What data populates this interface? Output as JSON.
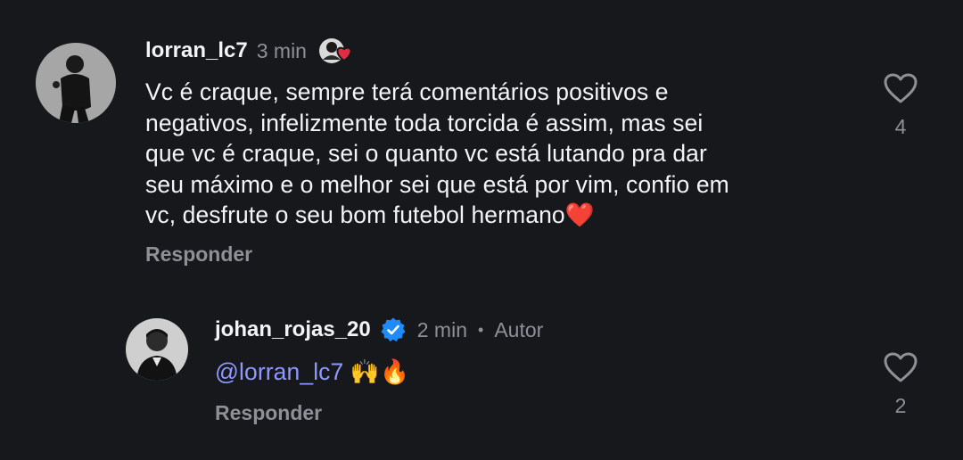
{
  "top_fragment": "·",
  "comments": [
    {
      "username": "lorran_lc7",
      "time": "3 min",
      "text_lines": [
        "Vc é craque, sempre terá comentários positivos e",
        "negativos, infelizmente toda torcida é assim, mas sei",
        "que vc é craque, sei o quanto vc está lutando pra dar",
        "seu máximo e o melhor sei que está por vim, confio em",
        "vc, desfrute o seu bom futebol hermano"
      ],
      "text_emoji": "❤️",
      "reply_label": "Responder",
      "likes": "4",
      "badge_icon": "creator-heart-badge-icon"
    },
    {
      "username": "johan_rojas_20",
      "verified_icon": "verified-check-icon",
      "time": "2 min",
      "dot": "•",
      "author_label": "Autor",
      "mention": "@lorran_lc7",
      "emoji": "🙌🔥",
      "reply_label": "Responder",
      "likes": "2"
    }
  ],
  "colors": {
    "background": "#17181c",
    "primary_text": "#f3f4f6",
    "secondary_text": "#8d9096",
    "mention": "#8f98ff",
    "verified": "#1f8bf8",
    "heart_red": "#e02d3f"
  }
}
